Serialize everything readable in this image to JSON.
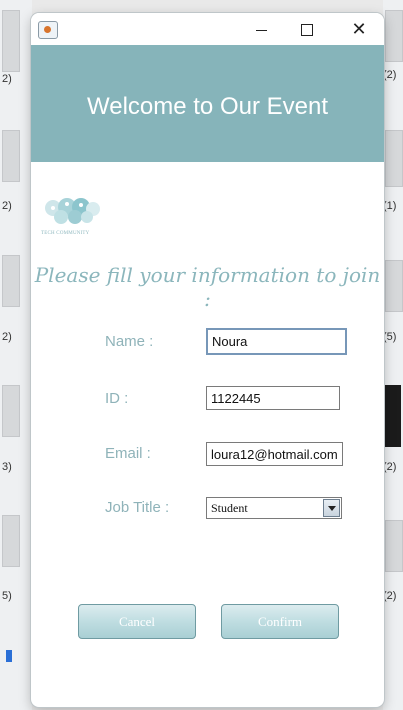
{
  "window": {
    "controls": {
      "minimize_icon": "minimize-icon",
      "maximize_icon": "maximize-icon",
      "close_glyph": "✕"
    }
  },
  "banner": {
    "title": "Welcome to Our Event",
    "color": "#86b4ba"
  },
  "logo": {
    "text": "TECH COMMUNITY"
  },
  "form": {
    "prompt": "Please fill your information to join :",
    "name": {
      "label": "Name :",
      "value": "Noura"
    },
    "id": {
      "label": "ID :",
      "value": "1122445"
    },
    "email": {
      "label": "Email :",
      "value": "loura12@hotmail.com"
    },
    "job_title": {
      "label": "Job Title :",
      "selected": "Student"
    }
  },
  "buttons": {
    "cancel": "Cancel",
    "confirm": "Confirm"
  },
  "background": {
    "counts_left": [
      "2)",
      "2)",
      "2)",
      "3)",
      "5)"
    ],
    "counts_right": [
      "(2)",
      "(1)",
      "(5)",
      "(2)",
      "(2)"
    ]
  }
}
